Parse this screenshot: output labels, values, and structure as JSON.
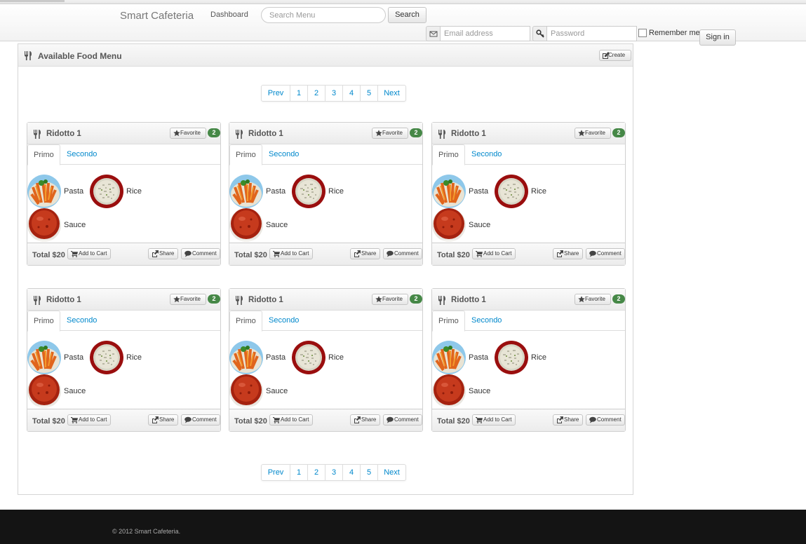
{
  "header": {
    "brand": "Smart Cafeteria",
    "nav_dashboard": "Dashboard",
    "search_placeholder": "Search Menu",
    "search_button": "Search",
    "email_placeholder": "Email address",
    "password_placeholder": "Password",
    "remember_label": "Remember me",
    "signin_button": "Sign in"
  },
  "panel": {
    "title": "Available Food Menu",
    "create_button": "Create",
    "pagination": [
      "Prev",
      "1",
      "2",
      "3",
      "4",
      "5",
      "Next"
    ]
  },
  "cards": [
    {
      "title": "Ridotto 1",
      "favorite_label": "Favorite",
      "favorite_count": "2",
      "tabs": [
        "Primo",
        "Secondo"
      ],
      "foods": [
        "Pasta",
        "Rice",
        "Sauce"
      ],
      "total": "Total $20",
      "add_to_cart": "Add to Cart",
      "share": "Share",
      "comment": "Comment"
    },
    {
      "title": "Ridotto 1",
      "favorite_label": "Favorite",
      "favorite_count": "2",
      "tabs": [
        "Primo",
        "Secondo"
      ],
      "foods": [
        "Pasta",
        "Rice",
        "Sauce"
      ],
      "total": "Total $20",
      "add_to_cart": "Add to Cart",
      "share": "Share",
      "comment": "Comment"
    },
    {
      "title": "Ridotto 1",
      "favorite_label": "Favorite",
      "favorite_count": "2",
      "tabs": [
        "Primo",
        "Secondo"
      ],
      "foods": [
        "Pasta",
        "Rice",
        "Sauce"
      ],
      "total": "Total $20",
      "add_to_cart": "Add to Cart",
      "share": "Share",
      "comment": "Comment"
    },
    {
      "title": "Ridotto 1",
      "favorite_label": "Favorite",
      "favorite_count": "2",
      "tabs": [
        "Primo",
        "Secondo"
      ],
      "foods": [
        "Pasta",
        "Rice",
        "Sauce"
      ],
      "total": "Total $20",
      "add_to_cart": "Add to Cart",
      "share": "Share",
      "comment": "Comment"
    },
    {
      "title": "Ridotto 1",
      "favorite_label": "Favorite",
      "favorite_count": "2",
      "tabs": [
        "Primo",
        "Secondo"
      ],
      "foods": [
        "Pasta",
        "Rice",
        "Sauce"
      ],
      "total": "Total $20",
      "add_to_cart": "Add to Cart",
      "share": "Share",
      "comment": "Comment"
    },
    {
      "title": "Ridotto 1",
      "favorite_label": "Favorite",
      "favorite_count": "2",
      "tabs": [
        "Primo",
        "Secondo"
      ],
      "foods": [
        "Pasta",
        "Rice",
        "Sauce"
      ],
      "total": "Total $20",
      "add_to_cart": "Add to Cart",
      "share": "Share",
      "comment": "Comment"
    }
  ],
  "icons": {
    "menu": "fork-knife-icon",
    "create": "edit-icon",
    "favorite": "star-icon",
    "cart": "cart-icon",
    "share": "share-icon",
    "comment": "comment-icon",
    "email": "envelope-icon",
    "password": "key-icon"
  },
  "colors": {
    "link": "#0088cc",
    "badge": "#468847",
    "footer": "#141414"
  },
  "footer": {
    "copyright": "© 2012 Smart Cafeteria."
  }
}
